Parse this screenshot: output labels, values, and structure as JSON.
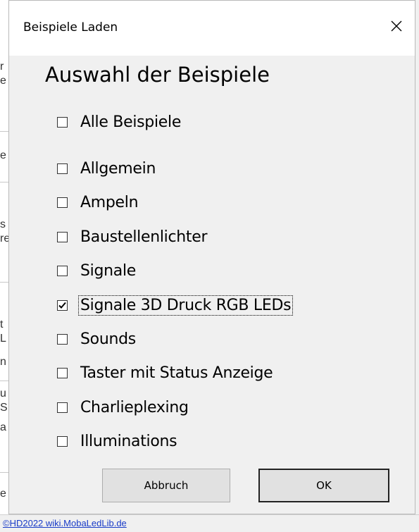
{
  "background": {
    "fragments": [
      "r",
      "e",
      "e",
      "s",
      "re",
      "t",
      "L",
      "n",
      "u",
      "S",
      "a",
      "e"
    ],
    "footer_link": "©HD2022 wiki.MobaLedLib.de"
  },
  "dialog": {
    "title": "Beispiele Laden",
    "close_symbol": "✕",
    "heading": "Auswahl der Beispiele",
    "all_checkbox": {
      "label": "Alle Beispiele",
      "checked": false
    },
    "items": [
      {
        "label": "Allgemein",
        "checked": false
      },
      {
        "label": "Ampeln",
        "checked": false
      },
      {
        "label": "Baustellenlichter",
        "checked": false
      },
      {
        "label": "Signale",
        "checked": false
      },
      {
        "label": "Signale 3D Druck RGB LEDs",
        "checked": true,
        "focused": true
      },
      {
        "label": "Sounds",
        "checked": false
      },
      {
        "label": "Taster mit Status Anzeige",
        "checked": false
      },
      {
        "label": "Charlieplexing",
        "checked": false
      },
      {
        "label": "Illuminations",
        "checked": false
      }
    ],
    "buttons": {
      "cancel": "Abbruch",
      "ok": "OK"
    }
  }
}
